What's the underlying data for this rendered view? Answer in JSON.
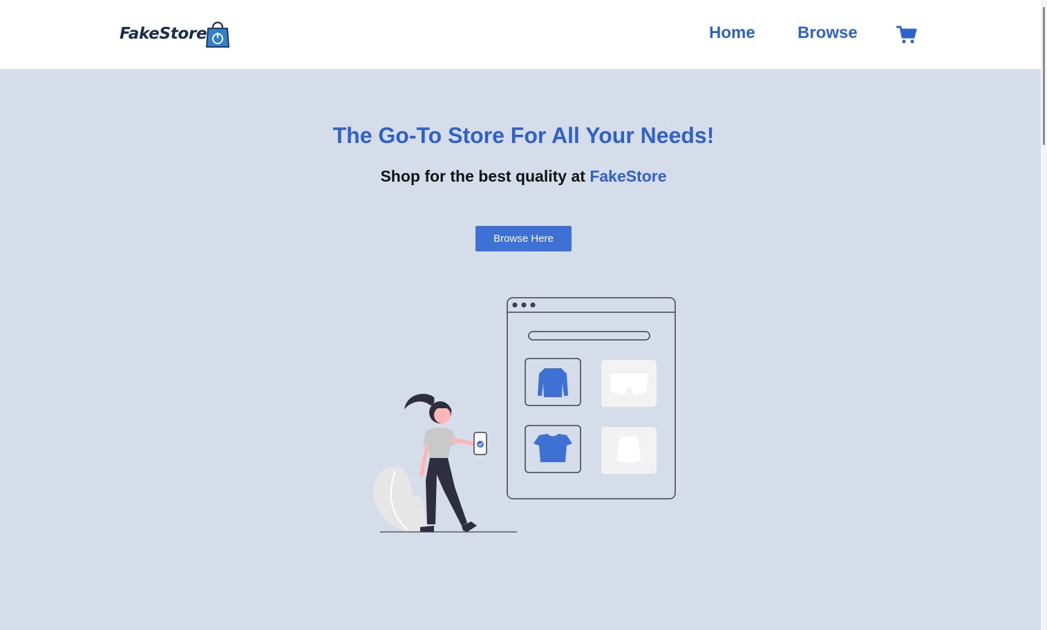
{
  "header": {
    "logo_text": "FakeStore",
    "nav": [
      {
        "label": "Home"
      },
      {
        "label": "Browse"
      }
    ],
    "cart_icon": "shopping-cart-icon"
  },
  "hero": {
    "title": "The Go-To Store For All Your Needs!",
    "subtitle_prefix": "Shop for the best quality at ",
    "subtitle_brand": "FakeStore",
    "button_label": "Browse Here"
  },
  "colors": {
    "accent": "#2e61c9",
    "button": "#3f71d4",
    "background": "#d5dcea",
    "header_bg": "#ffffff",
    "logo_dark": "#1a2c4c"
  },
  "illustration": "woman-shopping-online-illustration"
}
